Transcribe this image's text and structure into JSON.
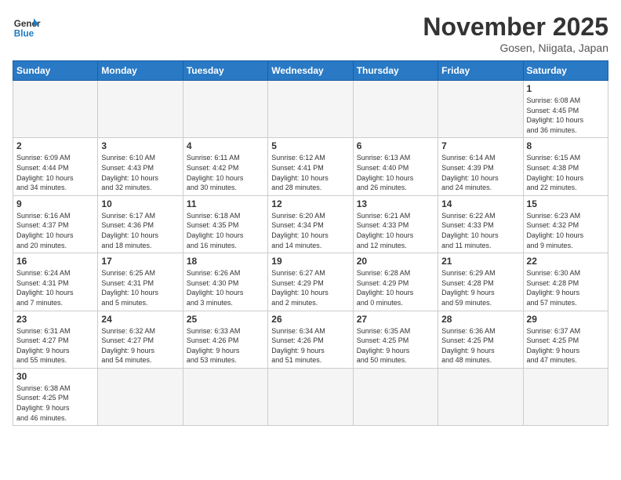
{
  "header": {
    "logo_general": "General",
    "logo_blue": "Blue",
    "month_title": "November 2025",
    "location": "Gosen, Niigata, Japan"
  },
  "weekdays": [
    "Sunday",
    "Monday",
    "Tuesday",
    "Wednesday",
    "Thursday",
    "Friday",
    "Saturday"
  ],
  "weeks": [
    [
      {
        "day": "",
        "info": ""
      },
      {
        "day": "",
        "info": ""
      },
      {
        "day": "",
        "info": ""
      },
      {
        "day": "",
        "info": ""
      },
      {
        "day": "",
        "info": ""
      },
      {
        "day": "",
        "info": ""
      },
      {
        "day": "1",
        "info": "Sunrise: 6:08 AM\nSunset: 4:45 PM\nDaylight: 10 hours\nand 36 minutes."
      }
    ],
    [
      {
        "day": "2",
        "info": "Sunrise: 6:09 AM\nSunset: 4:44 PM\nDaylight: 10 hours\nand 34 minutes."
      },
      {
        "day": "3",
        "info": "Sunrise: 6:10 AM\nSunset: 4:43 PM\nDaylight: 10 hours\nand 32 minutes."
      },
      {
        "day": "4",
        "info": "Sunrise: 6:11 AM\nSunset: 4:42 PM\nDaylight: 10 hours\nand 30 minutes."
      },
      {
        "day": "5",
        "info": "Sunrise: 6:12 AM\nSunset: 4:41 PM\nDaylight: 10 hours\nand 28 minutes."
      },
      {
        "day": "6",
        "info": "Sunrise: 6:13 AM\nSunset: 4:40 PM\nDaylight: 10 hours\nand 26 minutes."
      },
      {
        "day": "7",
        "info": "Sunrise: 6:14 AM\nSunset: 4:39 PM\nDaylight: 10 hours\nand 24 minutes."
      },
      {
        "day": "8",
        "info": "Sunrise: 6:15 AM\nSunset: 4:38 PM\nDaylight: 10 hours\nand 22 minutes."
      }
    ],
    [
      {
        "day": "9",
        "info": "Sunrise: 6:16 AM\nSunset: 4:37 PM\nDaylight: 10 hours\nand 20 minutes."
      },
      {
        "day": "10",
        "info": "Sunrise: 6:17 AM\nSunset: 4:36 PM\nDaylight: 10 hours\nand 18 minutes."
      },
      {
        "day": "11",
        "info": "Sunrise: 6:18 AM\nSunset: 4:35 PM\nDaylight: 10 hours\nand 16 minutes."
      },
      {
        "day": "12",
        "info": "Sunrise: 6:20 AM\nSunset: 4:34 PM\nDaylight: 10 hours\nand 14 minutes."
      },
      {
        "day": "13",
        "info": "Sunrise: 6:21 AM\nSunset: 4:33 PM\nDaylight: 10 hours\nand 12 minutes."
      },
      {
        "day": "14",
        "info": "Sunrise: 6:22 AM\nSunset: 4:33 PM\nDaylight: 10 hours\nand 11 minutes."
      },
      {
        "day": "15",
        "info": "Sunrise: 6:23 AM\nSunset: 4:32 PM\nDaylight: 10 hours\nand 9 minutes."
      }
    ],
    [
      {
        "day": "16",
        "info": "Sunrise: 6:24 AM\nSunset: 4:31 PM\nDaylight: 10 hours\nand 7 minutes."
      },
      {
        "day": "17",
        "info": "Sunrise: 6:25 AM\nSunset: 4:31 PM\nDaylight: 10 hours\nand 5 minutes."
      },
      {
        "day": "18",
        "info": "Sunrise: 6:26 AM\nSunset: 4:30 PM\nDaylight: 10 hours\nand 3 minutes."
      },
      {
        "day": "19",
        "info": "Sunrise: 6:27 AM\nSunset: 4:29 PM\nDaylight: 10 hours\nand 2 minutes."
      },
      {
        "day": "20",
        "info": "Sunrise: 6:28 AM\nSunset: 4:29 PM\nDaylight: 10 hours\nand 0 minutes."
      },
      {
        "day": "21",
        "info": "Sunrise: 6:29 AM\nSunset: 4:28 PM\nDaylight: 9 hours\nand 59 minutes."
      },
      {
        "day": "22",
        "info": "Sunrise: 6:30 AM\nSunset: 4:28 PM\nDaylight: 9 hours\nand 57 minutes."
      }
    ],
    [
      {
        "day": "23",
        "info": "Sunrise: 6:31 AM\nSunset: 4:27 PM\nDaylight: 9 hours\nand 55 minutes."
      },
      {
        "day": "24",
        "info": "Sunrise: 6:32 AM\nSunset: 4:27 PM\nDaylight: 9 hours\nand 54 minutes."
      },
      {
        "day": "25",
        "info": "Sunrise: 6:33 AM\nSunset: 4:26 PM\nDaylight: 9 hours\nand 53 minutes."
      },
      {
        "day": "26",
        "info": "Sunrise: 6:34 AM\nSunset: 4:26 PM\nDaylight: 9 hours\nand 51 minutes."
      },
      {
        "day": "27",
        "info": "Sunrise: 6:35 AM\nSunset: 4:25 PM\nDaylight: 9 hours\nand 50 minutes."
      },
      {
        "day": "28",
        "info": "Sunrise: 6:36 AM\nSunset: 4:25 PM\nDaylight: 9 hours\nand 48 minutes."
      },
      {
        "day": "29",
        "info": "Sunrise: 6:37 AM\nSunset: 4:25 PM\nDaylight: 9 hours\nand 47 minutes."
      }
    ],
    [
      {
        "day": "30",
        "info": "Sunrise: 6:38 AM\nSunset: 4:25 PM\nDaylight: 9 hours\nand 46 minutes."
      },
      {
        "day": "",
        "info": ""
      },
      {
        "day": "",
        "info": ""
      },
      {
        "day": "",
        "info": ""
      },
      {
        "day": "",
        "info": ""
      },
      {
        "day": "",
        "info": ""
      },
      {
        "day": "",
        "info": ""
      }
    ]
  ]
}
